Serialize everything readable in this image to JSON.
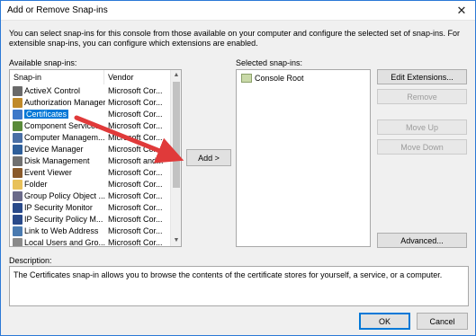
{
  "window": {
    "title": "Add or Remove Snap-ins",
    "close_glyph": "✕"
  },
  "intro_text": "You can select snap-ins for this console from those available on your computer and configure the selected set of snap-ins. For extensible snap-ins, you can configure which extensions are enabled.",
  "available": {
    "label": "Available snap-ins:",
    "columns": [
      "Snap-in",
      "Vendor"
    ],
    "rows": [
      {
        "name": "ActiveX Control",
        "vendor": "Microsoft Cor...",
        "icon": "activex-icon",
        "color": "#6a6a6a"
      },
      {
        "name": "Authorization Manager",
        "vendor": "Microsoft Cor...",
        "icon": "authorization-icon",
        "color": "#c08a2a"
      },
      {
        "name": "Certificates",
        "vendor": "Microsoft Cor...",
        "icon": "certificates-icon",
        "color": "#3c78c8",
        "selected": true
      },
      {
        "name": "Component Services",
        "vendor": "Microsoft Cor...",
        "icon": "component-services-icon",
        "color": "#5a8a3a"
      },
      {
        "name": "Computer Managem...",
        "vendor": "Microsoft Cor...",
        "icon": "computer-management-icon",
        "color": "#4a6fa5"
      },
      {
        "name": "Device Manager",
        "vendor": "Microsoft Cor...",
        "icon": "device-manager-icon",
        "color": "#2f5f9a"
      },
      {
        "name": "Disk Management",
        "vendor": "Microsoft and...",
        "icon": "disk-management-icon",
        "color": "#707070"
      },
      {
        "name": "Event Viewer",
        "vendor": "Microsoft Cor...",
        "icon": "event-viewer-icon",
        "color": "#8a5a2a"
      },
      {
        "name": "Folder",
        "vendor": "Microsoft Cor...",
        "icon": "folder-icon",
        "color": "#e8c15a"
      },
      {
        "name": "Group Policy Object ...",
        "vendor": "Microsoft Cor...",
        "icon": "group-policy-icon",
        "color": "#6a6a8a"
      },
      {
        "name": "IP Security Monitor",
        "vendor": "Microsoft Cor...",
        "icon": "ip-security-monitor-icon",
        "color": "#2a4a8a"
      },
      {
        "name": "IP Security Policy M...",
        "vendor": "Microsoft Cor...",
        "icon": "ip-security-policy-icon",
        "color": "#2a4a8a"
      },
      {
        "name": "Link to Web Address",
        "vendor": "Microsoft Cor...",
        "icon": "link-icon",
        "color": "#4a7ab0"
      },
      {
        "name": "Local Users and Gro...",
        "vendor": "Microsoft Cor...",
        "icon": "local-users-icon",
        "color": "#8a8a8a"
      }
    ]
  },
  "add_button": "Add >",
  "selected": {
    "label": "Selected snap-ins:",
    "items": [
      {
        "name": "Console Root",
        "icon": "folder-icon",
        "color": "#c9d9a8"
      }
    ]
  },
  "side_buttons": {
    "edit_extensions": "Edit Extensions...",
    "remove": "Remove",
    "move_up": "Move Up",
    "move_down": "Move Down",
    "advanced": "Advanced..."
  },
  "description": {
    "label": "Description:",
    "text": "The Certificates snap-in allows you to browse the contents of the certificate stores for yourself, a service, or a computer."
  },
  "footer": {
    "ok": "OK",
    "cancel": "Cancel"
  },
  "annotation": {
    "arrow_color": "#e03a3a"
  }
}
